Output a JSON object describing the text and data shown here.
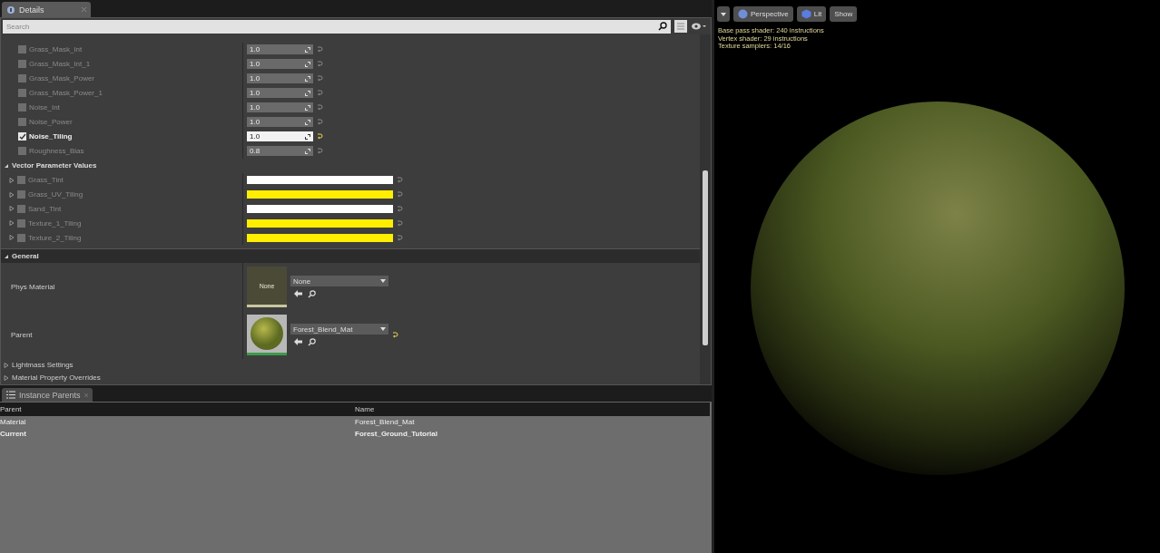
{
  "details_tab": {
    "title": "Details"
  },
  "search": {
    "placeholder": "Search"
  },
  "scalar_params": [
    {
      "name": "Grass_Mask_Int",
      "checked": false,
      "value": "1.0"
    },
    {
      "name": "Grass_Mask_Int_1",
      "checked": false,
      "value": "1.0"
    },
    {
      "name": "Grass_Mask_Power",
      "checked": false,
      "value": "1.0"
    },
    {
      "name": "Grass_Mask_Power_1",
      "checked": false,
      "value": "1.0"
    },
    {
      "name": "Noise_Int",
      "checked": false,
      "value": "1.0"
    },
    {
      "name": "Noise_Power",
      "checked": false,
      "value": "1.0"
    },
    {
      "name": "Noise_Tiling",
      "checked": true,
      "value": "1.0"
    },
    {
      "name": "Roughness_Bias",
      "checked": false,
      "value": "0.8"
    }
  ],
  "vector_section": {
    "title": "Vector Parameter Values",
    "expanded": true
  },
  "vector_params": [
    {
      "name": "Grass_Tint",
      "checked": false,
      "color": "#ffffff"
    },
    {
      "name": "Grass_UV_Tiling",
      "checked": false,
      "color": "#ffee00"
    },
    {
      "name": "Sand_Tint",
      "checked": false,
      "color": "#ffffff"
    },
    {
      "name": "Texture_1_Tiling",
      "checked": false,
      "color": "#ffee00"
    },
    {
      "name": "Texture_2_Tiling",
      "checked": false,
      "color": "#ffee00"
    }
  ],
  "general_section": {
    "title": "General",
    "expanded": true
  },
  "asset_rows": [
    {
      "kind": "empty",
      "label": "Phys Material",
      "thumbnail_text": "None",
      "value": "None",
      "modified": false
    },
    {
      "kind": "sphere",
      "label": "Parent",
      "value": "Forest_Blend_Mat",
      "modified": true
    }
  ],
  "collapsed_sections": [
    {
      "title": "Lightmass Settings",
      "expanded": false
    },
    {
      "title": "Material Property Overrides",
      "expanded": false
    }
  ],
  "instance_parents": {
    "title": "Instance Parents",
    "columns": [
      "Parent",
      "Name"
    ],
    "rows": [
      {
        "parent": "Material",
        "name": "Forest_Blend_Mat",
        "current": false
      },
      {
        "parent": "Current",
        "name": "Forest_Ground_Tutorial",
        "current": true
      }
    ]
  },
  "viewport": {
    "buttons": [
      {
        "label": "Perspective",
        "kind": "perspective"
      },
      {
        "label": "Lit",
        "kind": "lit"
      },
      {
        "label": "Show",
        "kind": "plain"
      }
    ],
    "stats": [
      "Base pass shader: 240 instructions",
      "Vertex shader: 29 instructions",
      "Texture samplers: 14/16"
    ]
  }
}
